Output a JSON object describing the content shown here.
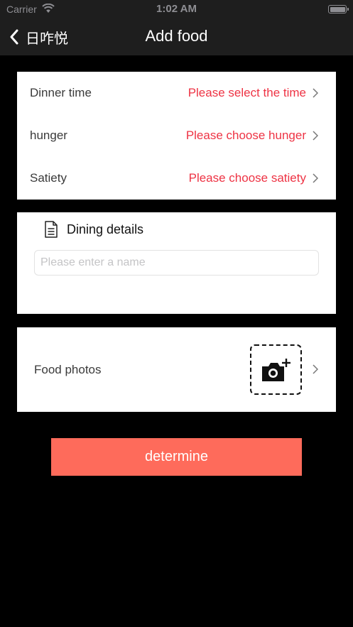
{
  "status_bar": {
    "carrier": "Carrier",
    "time": "1:02 AM"
  },
  "nav": {
    "back_label": "日咋悦",
    "title": "Add food"
  },
  "time_section": {
    "rows": [
      {
        "label": "Dinner time",
        "value": "Please select the time"
      },
      {
        "label": "hunger",
        "value": "Please choose hunger"
      },
      {
        "label": "Satiety",
        "value": "Please choose satiety"
      }
    ]
  },
  "details_section": {
    "title": "Dining details",
    "name_placeholder": "Please enter a name",
    "name_value": ""
  },
  "photos_section": {
    "label": "Food photos"
  },
  "submit": {
    "label": "determine"
  },
  "colors": {
    "accent_text": "#ee3344",
    "button": "#fe6b5b",
    "bar": "#1e1e1e",
    "background": "#000000"
  },
  "icons": [
    "wifi-icon",
    "battery-icon",
    "back-chevron-icon",
    "chevron-right-icon",
    "document-icon",
    "camera-add-icon"
  ]
}
